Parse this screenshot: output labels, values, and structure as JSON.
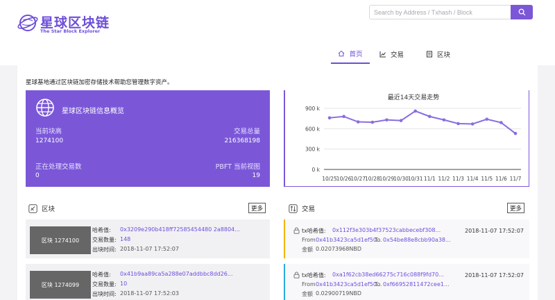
{
  "brand": {
    "title": "星球区块链",
    "subtitle": "The Star Block Explorer"
  },
  "search": {
    "placeholder": "Search by Address / Txhash / Block",
    "icon": "search-icon"
  },
  "nav": [
    {
      "label": "首页",
      "icon": "home-icon",
      "active": true
    },
    {
      "label": "交易",
      "icon": "chart-icon",
      "active": false
    },
    {
      "label": "区块",
      "icon": "list-icon",
      "active": false
    }
  ],
  "intro": "星球基地通过区块链加密存储技术帮助您管理数字资产。",
  "overview": {
    "title": "星球区块链信息概览",
    "current_height_label": "当前块高",
    "current_height": "1274100",
    "tx_total_label": "交易总量",
    "tx_total": "216368198",
    "pending_label": "正在处理交易数",
    "pending": "0",
    "pbft_label": "PBFT 当前视图",
    "pbft": "19"
  },
  "chart_data": {
    "type": "line",
    "title": "最近14天交易走势",
    "categories": [
      "10/25",
      "10/26",
      "10/27",
      "10/28",
      "10/29",
      "10/30",
      "10/31",
      "11/1",
      "11/2",
      "11/3",
      "11/4",
      "11/5",
      "11/6",
      "11/7"
    ],
    "values": [
      760000,
      780000,
      700000,
      695000,
      730000,
      720000,
      860000,
      780000,
      730000,
      675000,
      670000,
      740000,
      690000,
      530000
    ],
    "yticks": [
      "0 k",
      "300 k",
      "600 k",
      "900 k"
    ],
    "ylim": [
      0,
      900000
    ],
    "color": "#8a6ce0"
  },
  "blocks_panel": {
    "title": "区块",
    "more": "更多",
    "hash_label": "哈希值:",
    "count_label": "交易数量:",
    "time_label": "出块时间:",
    "items": [
      {
        "badge": "区块 1274100",
        "hash": "0x3209e290b418ff72585454480 2a8804...",
        "count": "148",
        "time": "2018-11-07 17:52:07"
      },
      {
        "badge": "区块 1274099",
        "hash": "0x41b9aa89ca5a288e07addbbc8dd26...",
        "count": "10",
        "time": "2018-11-07 17:52:03"
      }
    ]
  },
  "tx_panel": {
    "title": "交易",
    "more": "更多",
    "hash_label": "tx哈希值:",
    "from_label": "From",
    "to_label": "To",
    "amount_label": "金额",
    "items": [
      {
        "hash": "0x112f3e303b4f37523cabbecebf308...",
        "from": "0x41b3423ca5d1ef50...",
        "to": "0x54be88e8cbb90a38...",
        "amount": "0.02073968NBD",
        "time": "2018-11-07 17:52:07",
        "color": "#f0b400"
      },
      {
        "hash": "0xa1f62cb38ed66275c716c088f9fd70...",
        "from": "0x41b3423ca5d1ef50...",
        "to": "0xf66952811472cee1...",
        "amount": "0.02900719NBD",
        "time": "2018-11-07 17:52:07",
        "color": "#2aa7e0"
      }
    ]
  }
}
